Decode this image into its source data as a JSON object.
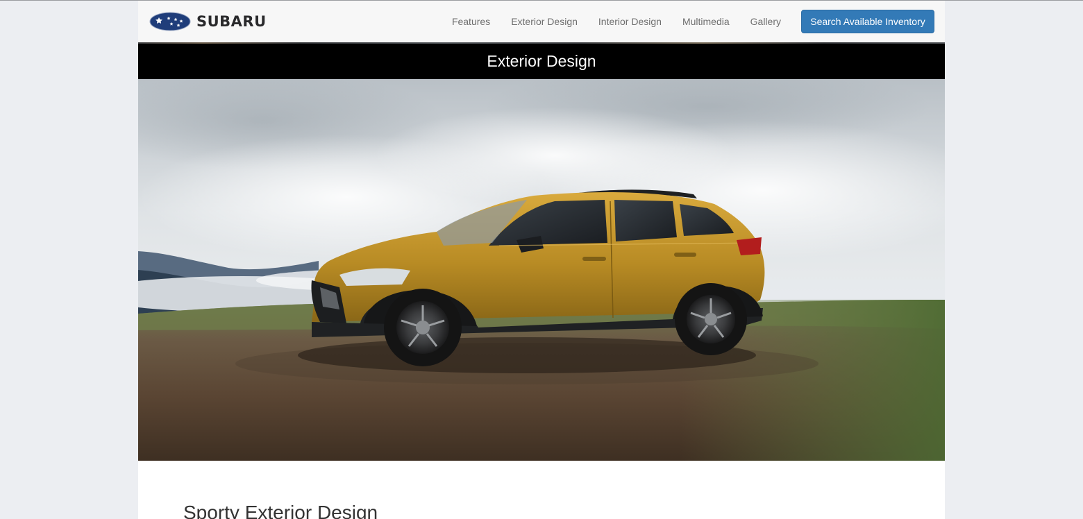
{
  "brand": {
    "name": "SUBARU",
    "colors": {
      "emblem_blue": "#1f3d7a",
      "cta_blue": "#337ab7"
    }
  },
  "nav": {
    "items": [
      {
        "label": "Features"
      },
      {
        "label": "Exterior Design"
      },
      {
        "label": "Interior Design"
      },
      {
        "label": "Multimedia"
      },
      {
        "label": "Gallery"
      }
    ],
    "cta_label": "Search Available Inventory"
  },
  "section": {
    "title": "Exterior Design"
  },
  "hero": {
    "image": "yellow-crossover-suv-on-hilltop-photo"
  },
  "content": {
    "heading": "Sporty Exterior Design"
  }
}
